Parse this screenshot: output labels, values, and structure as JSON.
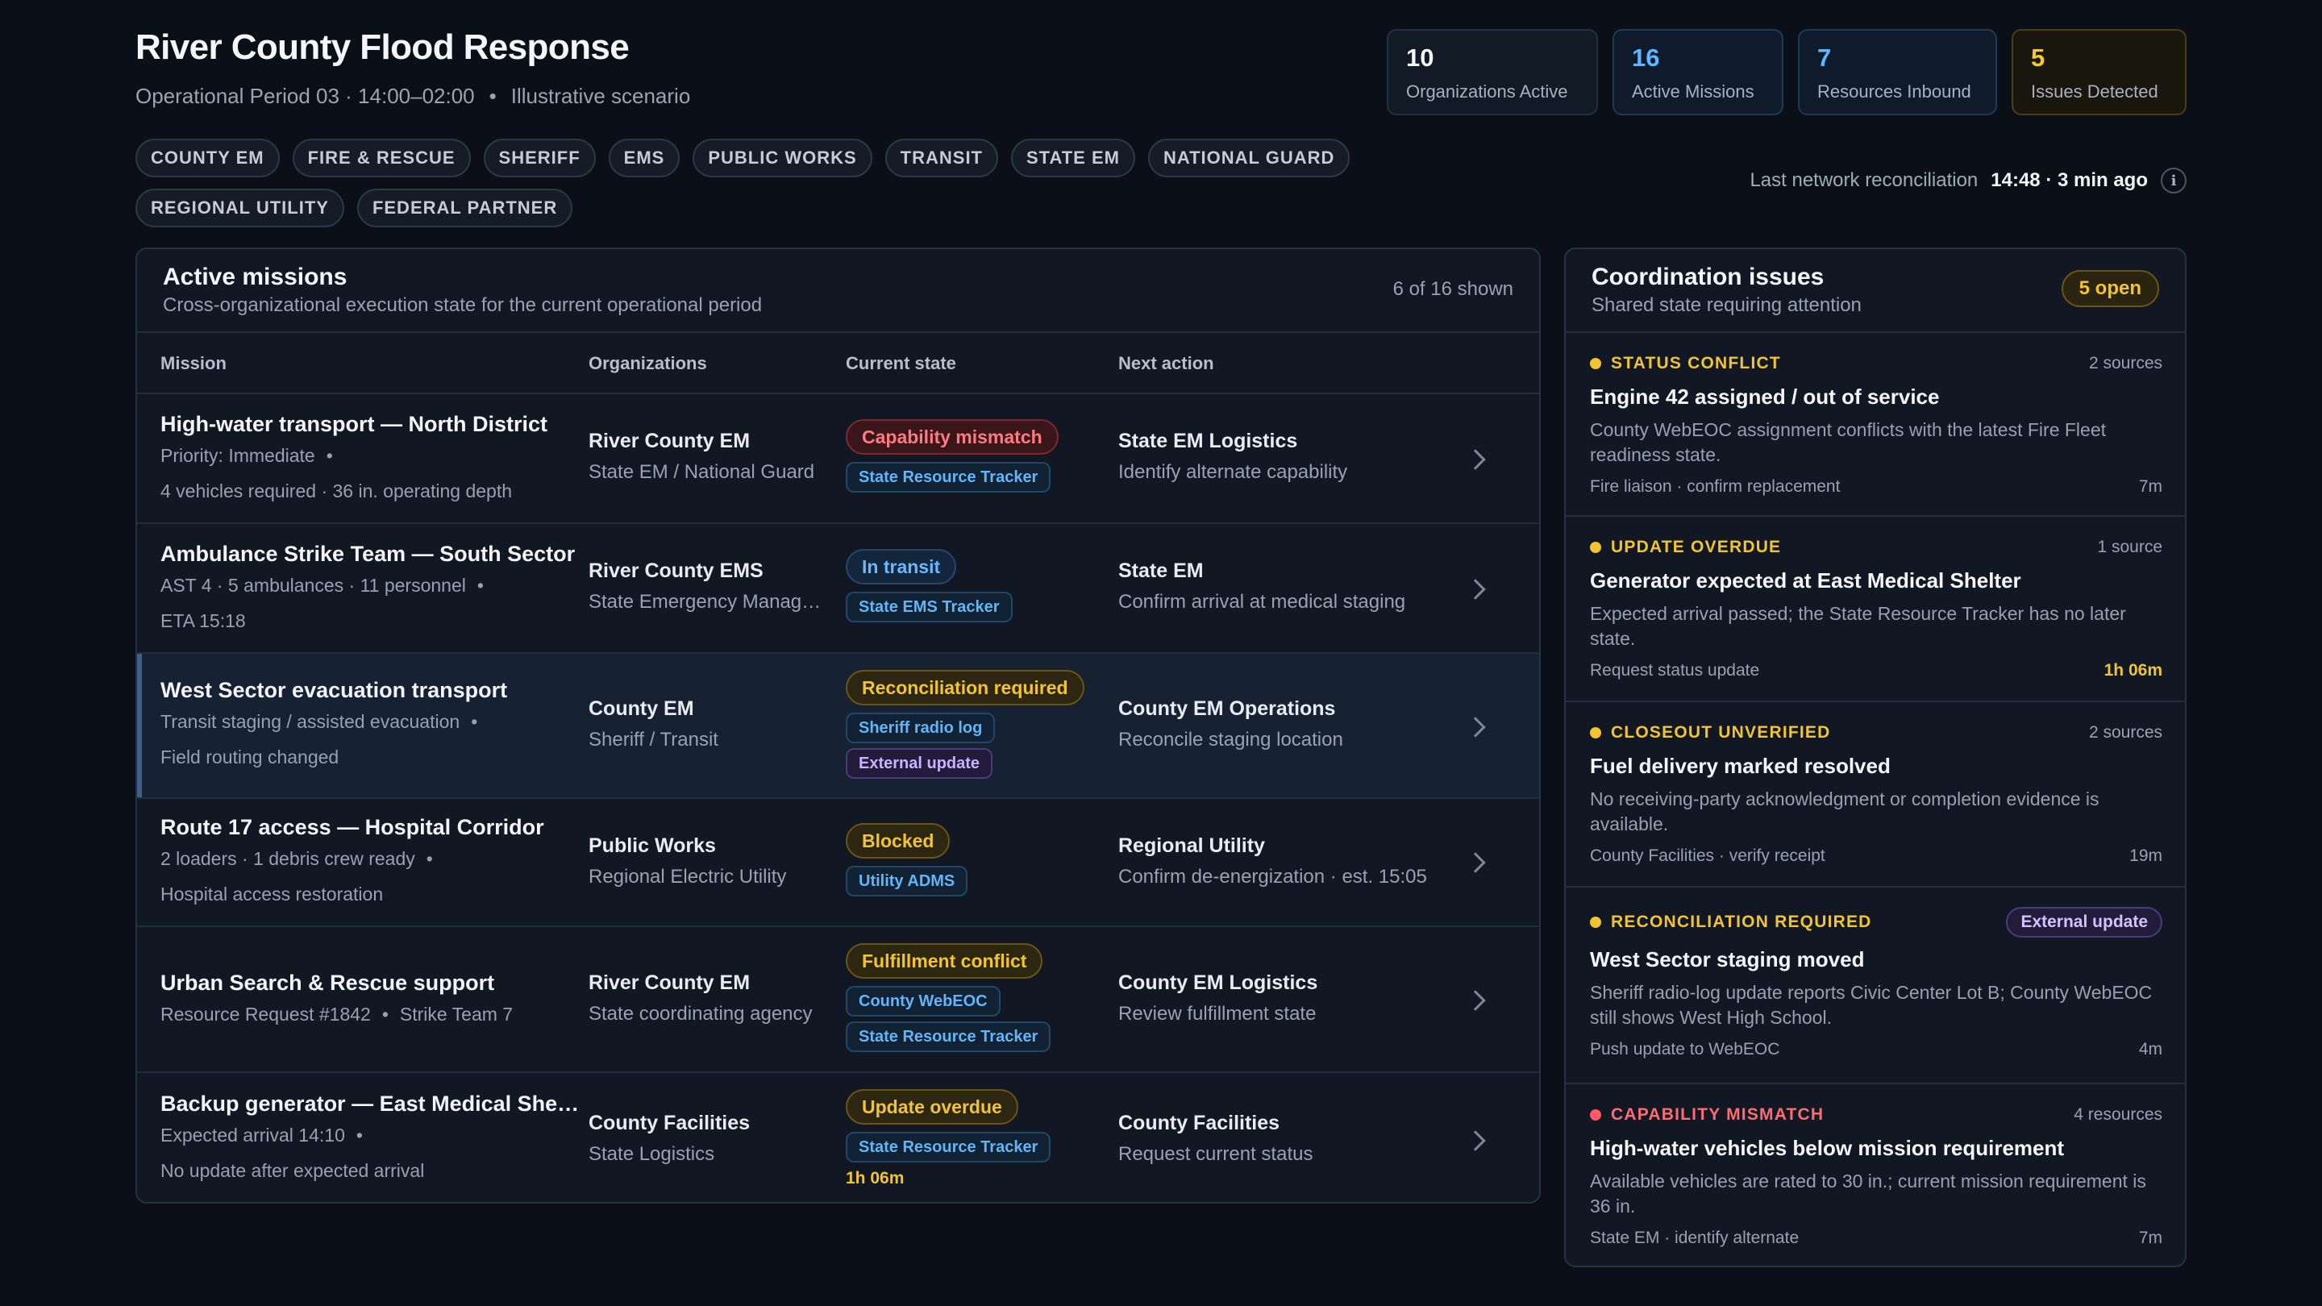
{
  "header": {
    "title": "River County Flood Response",
    "operational_period": "Operational Period 03 · 14:00–02:00",
    "separator": "•",
    "scenario": "Illustrative scenario"
  },
  "stats": [
    {
      "value": "10",
      "label": "Organizations Active",
      "color": "#f4f6fa"
    },
    {
      "value": "16",
      "label": "Active Missions",
      "color": "#5cb8ff"
    },
    {
      "value": "7",
      "label": "Resources Inbound",
      "color": "#5cb8ff"
    },
    {
      "value": "5",
      "label": "Issues Detected",
      "color": "#f5c82b"
    }
  ],
  "org_filters": [
    "COUNTY EM",
    "FIRE & RESCUE",
    "SHERIFF",
    "EMS",
    "PUBLIC WORKS",
    "TRANSIT",
    "STATE EM",
    "NATIONAL GUARD",
    "REGIONAL UTILITY",
    "FEDERAL PARTNER"
  ],
  "reconciliation": {
    "label": "Last network reconciliation",
    "value": "14:48 · 3 min ago",
    "icon": "info-icon",
    "icon_glyph": "i"
  },
  "missions": {
    "title": "Active missions",
    "subtitle": "Cross-organizational execution state for the current operational period",
    "count": "6 of 16 shown",
    "columns": {
      "mission": "Mission",
      "organizations": "Organizations",
      "state": "Current state",
      "next": "Next action"
    },
    "rows": [
      {
        "name": "High-water transport — North District",
        "meta": "Priority: Immediate",
        "meta_dot": "•",
        "meta2": "4 vehicles required · 36 in. operating depth",
        "org": "River County EM",
        "org_sub": "State EM / National Guard",
        "state": "Capability mismatch",
        "state_color": "red",
        "tags": [
          {
            "label": "State Resource Tracker",
            "color": "blue"
          }
        ],
        "next": "State EM Logistics",
        "next_sub": "Identify alternate capability"
      },
      {
        "name": "Ambulance Strike Team — South Sector",
        "meta": "AST 4 · 5 ambulances · 11 personnel",
        "meta_dot": "•",
        "meta2": "ETA 15:18",
        "org": "River County EMS",
        "org_sub": "State Emergency Management",
        "state": "In transit",
        "state_color": "blue",
        "tags": [
          {
            "label": "State EMS Tracker",
            "color": "blue"
          }
        ],
        "next": "State EM",
        "next_sub": "Confirm arrival at medical staging"
      },
      {
        "name": "West Sector evacuation transport",
        "meta": "Transit staging / assisted evacuation",
        "meta_dot": "•",
        "meta2": "Field routing changed",
        "org": "County EM",
        "org_sub": "Sheriff / Transit",
        "state": "Reconciliation required",
        "state_color": "amber",
        "tags": [
          {
            "label": "Sheriff radio log",
            "color": "blue"
          },
          {
            "label": "External update",
            "color": "purple"
          }
        ],
        "next": "County EM Operations",
        "next_sub": "Reconcile staging location",
        "highlighted": true
      },
      {
        "name": "Route 17 access — Hospital Corridor",
        "meta": "2 loaders · 1 debris crew ready",
        "meta_dot": "•",
        "meta2": "Hospital access restoration",
        "org": "Public Works",
        "org_sub": "Regional Electric Utility",
        "state": "Blocked",
        "state_color": "amber",
        "tags": [
          {
            "label": "Utility ADMS",
            "color": "blue"
          }
        ],
        "next": "Regional Utility",
        "next_sub": "Confirm de-energization · est. 15:05"
      },
      {
        "name": "Urban Search & Rescue support",
        "meta": "Resource Request #1842",
        "meta_dot": "•",
        "meta_tail": "Strike Team 7",
        "meta2": "",
        "org": "River County EM",
        "org_sub": "State coordinating agency",
        "state": "Fulfillment conflict",
        "state_color": "amber",
        "tags": [
          {
            "label": "County WebEOC",
            "color": "blue"
          },
          {
            "label": "State Resource Tracker",
            "color": "blue"
          }
        ],
        "next": "County EM Logistics",
        "next_sub": "Review fulfillment state"
      },
      {
        "name": "Backup generator — East Medical Shelter",
        "meta": "Expected arrival 14:10",
        "meta_dot": "•",
        "meta2": "No update after expected arrival",
        "org": "County Facilities",
        "org_sub": "State Logistics",
        "state": "Update overdue",
        "state_color": "amber",
        "tags": [
          {
            "label": "State Resource Tracker",
            "color": "blue"
          }
        ],
        "elapsed": "1h 06m",
        "next": "County Facilities",
        "next_sub": "Request current status"
      }
    ]
  },
  "issues": {
    "title": "Coordination issues",
    "subtitle": "Shared state requiring attention",
    "badge": "5 open",
    "items": [
      {
        "kind": "STATUS CONFLICT",
        "color": "amber",
        "source": "2 sources",
        "title": "Engine 42 assigned / out of service",
        "desc": "County WebEOC assignment conflicts with the latest Fire Fleet readiness state.",
        "foot": "Fire liaison · confirm replacement",
        "time": "7m"
      },
      {
        "kind": "UPDATE OVERDUE",
        "color": "amber",
        "source": "1 source",
        "title": "Generator expected at East Medical Shelter",
        "desc": "Expected arrival passed; the State Resource Tracker has no later state.",
        "foot": "Request status update",
        "time": "1h 06m",
        "time_highlight": true
      },
      {
        "kind": "CLOSEOUT UNVERIFIED",
        "color": "amber",
        "source": "2 sources",
        "title": "Fuel delivery marked resolved",
        "desc": "No receiving-party acknowledgment or completion evidence is available.",
        "foot": "County Facilities · verify receipt",
        "time": "19m"
      },
      {
        "kind": "RECONCILIATION REQUIRED",
        "color": "amber",
        "badge": "External update",
        "title": "West Sector staging moved",
        "desc": "Sheriff radio-log update reports Civic Center Lot B; County WebEOC still shows West High School.",
        "foot": "Push update to WebEOC",
        "time": "4m"
      },
      {
        "kind": "CAPABILITY MISMATCH",
        "color": "red",
        "source": "4 resources",
        "title": "High-water vehicles below mission requirement",
        "desc": "Available vehicles are rated to 30 in.; current mission requirement is 36 in.",
        "foot": "State EM · identify alternate",
        "time": "7m"
      }
    ]
  }
}
